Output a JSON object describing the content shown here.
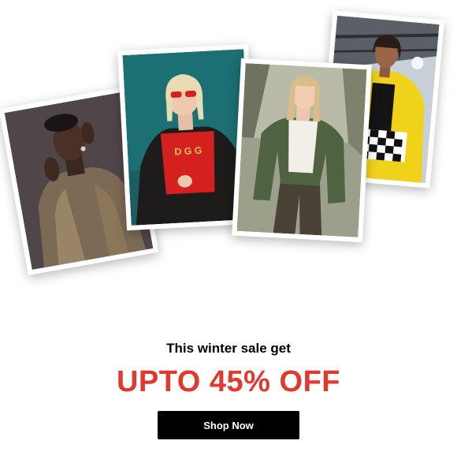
{
  "promo": {
    "headline": "This winter sale get",
    "offer": "UPTO 45% OFF",
    "cta_label": "Shop Now"
  },
  "colors": {
    "offer_red": "#e03a2f",
    "cta_bg": "#000000",
    "cta_text": "#ffffff"
  },
  "gallery": {
    "photos": [
      {
        "name": "model-fur-coat-photo"
      },
      {
        "name": "model-red-top-photo"
      },
      {
        "name": "model-green-blazer-photo"
      },
      {
        "name": "model-yellow-fur-photo"
      }
    ]
  }
}
